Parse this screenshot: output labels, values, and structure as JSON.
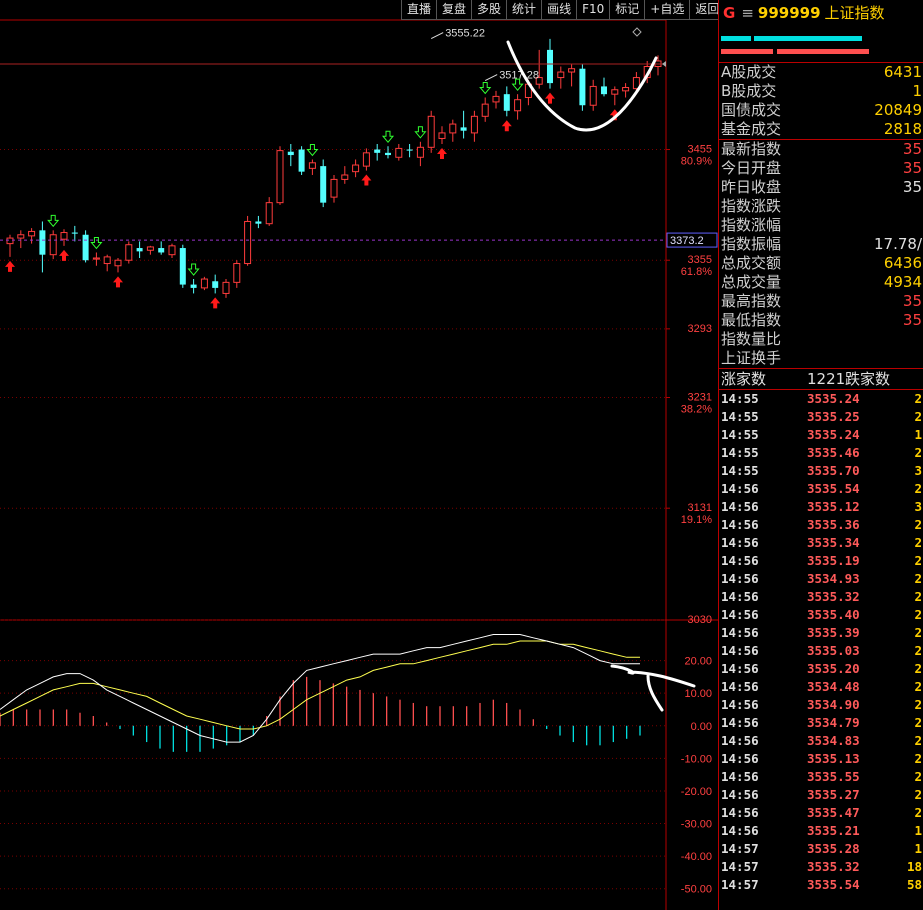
{
  "toolbar": [
    "直播",
    "复盘",
    "多股",
    "统计",
    "画线",
    "F10",
    "标记",
    "+自选",
    "返回"
  ],
  "header": {
    "prefix": "G",
    "eq": "≡",
    "code": "999999",
    "name": "上证指数"
  },
  "colors": {
    "up": "#ff3c3c",
    "down": "#54ffff",
    "axis": "#b40000",
    "dif": "#ffffff",
    "dea": "#ffff50",
    "cyanbar": "#00e0e0",
    "redbar": "#ff5050"
  },
  "stats": [
    {
      "label": "A股成交",
      "value": "6431",
      "color": "#ffd000"
    },
    {
      "label": "B股成交",
      "value": "1",
      "color": "#ffd000"
    },
    {
      "label": "国债成交",
      "value": "20849",
      "color": "#ffd000"
    },
    {
      "label": "基金成交",
      "value": "2818",
      "color": "#ffd000"
    },
    {
      "label": "最新指数",
      "value": "35",
      "color": "#ff4040",
      "sep": true
    },
    {
      "label": "今日开盘",
      "value": "35",
      "color": "#ff4040"
    },
    {
      "label": "昨日收盘",
      "value": "35",
      "color": "#e0e0e0"
    },
    {
      "label": "指数涨跌",
      "value": "",
      "color": "#ff4040"
    },
    {
      "label": "指数涨幅",
      "value": "",
      "color": "#ff4040"
    },
    {
      "label": "指数振幅",
      "value": "17.78/",
      "color": "#e0e0e0"
    },
    {
      "label": "总成交额",
      "value": "6436",
      "color": "#ffd000"
    },
    {
      "label": "总成交量",
      "value": "4934",
      "color": "#ffd000"
    },
    {
      "label": "最高指数",
      "value": "35",
      "color": "#ff4040"
    },
    {
      "label": "最低指数",
      "value": "35",
      "color": "#ff4040"
    },
    {
      "label": "指数量比",
      "value": "",
      "color": "#e0e0e0"
    },
    {
      "label": "上证换手",
      "value": "",
      "color": "#e0e0e0"
    }
  ],
  "advance": {
    "up_label": "涨家数",
    "up_value": "1221",
    "down_label": "跌家数"
  },
  "ticks": [
    {
      "t": "14:55",
      "p": "3535.24",
      "v": "2"
    },
    {
      "t": "14:55",
      "p": "3535.25",
      "v": "2"
    },
    {
      "t": "14:55",
      "p": "3535.24",
      "v": "1"
    },
    {
      "t": "14:55",
      "p": "3535.46",
      "v": "2"
    },
    {
      "t": "14:55",
      "p": "3535.70",
      "v": "3"
    },
    {
      "t": "14:56",
      "p": "3535.54",
      "v": "2"
    },
    {
      "t": "14:56",
      "p": "3535.12",
      "v": "3"
    },
    {
      "t": "14:56",
      "p": "3535.36",
      "v": "2"
    },
    {
      "t": "14:56",
      "p": "3535.34",
      "v": "2"
    },
    {
      "t": "14:56",
      "p": "3535.19",
      "v": "2"
    },
    {
      "t": "14:56",
      "p": "3534.93",
      "v": "2"
    },
    {
      "t": "14:56",
      "p": "3535.32",
      "v": "2"
    },
    {
      "t": "14:56",
      "p": "3535.40",
      "v": "2"
    },
    {
      "t": "14:56",
      "p": "3535.39",
      "v": "2"
    },
    {
      "t": "14:56",
      "p": "3535.03",
      "v": "2"
    },
    {
      "t": "14:56",
      "p": "3535.20",
      "v": "2"
    },
    {
      "t": "14:56",
      "p": "3534.48",
      "v": "2"
    },
    {
      "t": "14:56",
      "p": "3534.90",
      "v": "2"
    },
    {
      "t": "14:56",
      "p": "3534.79",
      "v": "2"
    },
    {
      "t": "14:56",
      "p": "3534.83",
      "v": "2"
    },
    {
      "t": "14:56",
      "p": "3535.13",
      "v": "2"
    },
    {
      "t": "14:56",
      "p": "3535.55",
      "v": "2"
    },
    {
      "t": "14:56",
      "p": "3535.27",
      "v": "2"
    },
    {
      "t": "14:56",
      "p": "3535.47",
      "v": "2"
    },
    {
      "t": "14:56",
      "p": "3535.21",
      "v": "1"
    },
    {
      "t": "14:57",
      "p": "3535.28",
      "v": "1"
    },
    {
      "t": "14:57",
      "p": "3535.32",
      "v": "18"
    },
    {
      "t": "14:57",
      "p": "3535.54",
      "v": "58"
    }
  ],
  "chart_data": {
    "type": "candlestick",
    "price_axis": {
      "range": [
        3030,
        3572
      ],
      "ticks": [
        {
          "value": 3455,
          "label": "3455",
          "pct": "80.9%"
        },
        {
          "value": 3355,
          "label": "3355",
          "pct": "61.8%"
        },
        {
          "value": 3293,
          "label": "3293",
          "pct": ""
        },
        {
          "value": 3231,
          "label": "3231",
          "pct": "38.2%"
        },
        {
          "value": 3131,
          "label": "3131",
          "pct": "19.1%"
        },
        {
          "value": 3030,
          "label": "3030",
          "pct": ""
        }
      ]
    },
    "current_price_label": "3373.2",
    "current_price_value": 3373.2,
    "annotations": [
      {
        "label": "3555.22",
        "value": 3555.22,
        "index": 39
      },
      {
        "label": "3517.28",
        "value": 3517.28,
        "index": 44
      }
    ],
    "candles": [
      {
        "o": 3370,
        "h": 3378,
        "l": 3358,
        "c": 3375
      },
      {
        "o": 3375,
        "h": 3382,
        "l": 3366,
        "c": 3378
      },
      {
        "o": 3377,
        "h": 3384,
        "l": 3370,
        "c": 3381
      },
      {
        "o": 3382,
        "h": 3390,
        "l": 3344,
        "c": 3360
      },
      {
        "o": 3360,
        "h": 3382,
        "l": 3356,
        "c": 3378
      },
      {
        "o": 3374,
        "h": 3383,
        "l": 3368,
        "c": 3380
      },
      {
        "o": 3380,
        "h": 3386,
        "l": 3372,
        "c": 3379
      },
      {
        "o": 3378,
        "h": 3382,
        "l": 3353,
        "c": 3355
      },
      {
        "o": 3356,
        "h": 3362,
        "l": 3350,
        "c": 3357
      },
      {
        "o": 3352,
        "h": 3360,
        "l": 3345,
        "c": 3358
      },
      {
        "o": 3350,
        "h": 3357,
        "l": 3344,
        "c": 3355
      },
      {
        "o": 3355,
        "h": 3372,
        "l": 3352,
        "c": 3369
      },
      {
        "o": 3366,
        "h": 3372,
        "l": 3357,
        "c": 3363
      },
      {
        "o": 3364,
        "h": 3368,
        "l": 3360,
        "c": 3367
      },
      {
        "o": 3366,
        "h": 3372,
        "l": 3360,
        "c": 3362
      },
      {
        "o": 3360,
        "h": 3370,
        "l": 3357,
        "c": 3368
      },
      {
        "o": 3366,
        "h": 3369,
        "l": 3330,
        "c": 3333
      },
      {
        "o": 3333,
        "h": 3338,
        "l": 3325,
        "c": 3330
      },
      {
        "o": 3330,
        "h": 3340,
        "l": 3328,
        "c": 3338
      },
      {
        "o": 3336,
        "h": 3342,
        "l": 3325,
        "c": 3330
      },
      {
        "o": 3325,
        "h": 3338,
        "l": 3321,
        "c": 3335
      },
      {
        "o": 3335,
        "h": 3355,
        "l": 3330,
        "c": 3352
      },
      {
        "o": 3352,
        "h": 3395,
        "l": 3350,
        "c": 3390
      },
      {
        "o": 3390,
        "h": 3395,
        "l": 3384,
        "c": 3388
      },
      {
        "o": 3388,
        "h": 3412,
        "l": 3386,
        "c": 3407
      },
      {
        "o": 3407,
        "h": 3458,
        "l": 3405,
        "c": 3454
      },
      {
        "o": 3453,
        "h": 3460,
        "l": 3440,
        "c": 3450
      },
      {
        "o": 3455,
        "h": 3458,
        "l": 3432,
        "c": 3435
      },
      {
        "o": 3438,
        "h": 3446,
        "l": 3432,
        "c": 3443
      },
      {
        "o": 3440,
        "h": 3446,
        "l": 3403,
        "c": 3407
      },
      {
        "o": 3412,
        "h": 3432,
        "l": 3407,
        "c": 3428
      },
      {
        "o": 3428,
        "h": 3440,
        "l": 3424,
        "c": 3432
      },
      {
        "o": 3435,
        "h": 3446,
        "l": 3430,
        "c": 3441
      },
      {
        "o": 3440,
        "h": 3456,
        "l": 3436,
        "c": 3452
      },
      {
        "o": 3455,
        "h": 3460,
        "l": 3445,
        "c": 3452
      },
      {
        "o": 3452,
        "h": 3458,
        "l": 3447,
        "c": 3450
      },
      {
        "o": 3448,
        "h": 3460,
        "l": 3445,
        "c": 3456
      },
      {
        "o": 3455,
        "h": 3460,
        "l": 3448,
        "c": 3454
      },
      {
        "o": 3448,
        "h": 3462,
        "l": 3440,
        "c": 3457
      },
      {
        "o": 3457,
        "h": 3490,
        "l": 3452,
        "c": 3485
      },
      {
        "o": 3465,
        "h": 3476,
        "l": 3460,
        "c": 3470
      },
      {
        "o": 3470,
        "h": 3482,
        "l": 3462,
        "c": 3478
      },
      {
        "o": 3475,
        "h": 3490,
        "l": 3465,
        "c": 3472
      },
      {
        "o": 3470,
        "h": 3490,
        "l": 3462,
        "c": 3485
      },
      {
        "o": 3485,
        "h": 3502,
        "l": 3480,
        "c": 3496
      },
      {
        "o": 3498,
        "h": 3508,
        "l": 3492,
        "c": 3503
      },
      {
        "o": 3505,
        "h": 3512,
        "l": 3485,
        "c": 3490
      },
      {
        "o": 3490,
        "h": 3505,
        "l": 3482,
        "c": 3500
      },
      {
        "o": 3502,
        "h": 3518,
        "l": 3495,
        "c": 3514
      },
      {
        "o": 3514,
        "h": 3545,
        "l": 3510,
        "c": 3520
      },
      {
        "o": 3545,
        "h": 3555,
        "l": 3510,
        "c": 3515
      },
      {
        "o": 3520,
        "h": 3530,
        "l": 3510,
        "c": 3525
      },
      {
        "o": 3525,
        "h": 3532,
        "l": 3512,
        "c": 3528
      },
      {
        "o": 3528,
        "h": 3532,
        "l": 3490,
        "c": 3495
      },
      {
        "o": 3495,
        "h": 3518,
        "l": 3490,
        "c": 3512
      },
      {
        "o": 3512,
        "h": 3520,
        "l": 3503,
        "c": 3505
      },
      {
        "o": 3505,
        "h": 3512,
        "l": 3495,
        "c": 3509
      },
      {
        "o": 3508,
        "h": 3515,
        "l": 3502,
        "c": 3511
      },
      {
        "o": 3510,
        "h": 3525,
        "l": 3505,
        "c": 3520
      },
      {
        "o": 3520,
        "h": 3535,
        "l": 3515,
        "c": 3530
      },
      {
        "o": 3530,
        "h": 3540,
        "l": 3522,
        "c": 3535
      }
    ],
    "up_arrow_index": [
      0,
      5,
      10,
      19,
      33,
      40,
      46,
      50,
      56
    ],
    "down_arrow_index": [
      4,
      8,
      17,
      28,
      35,
      38,
      44,
      47
    ],
    "macd": {
      "range": [
        -55,
        30
      ],
      "ticks": [
        20,
        10,
        0,
        -10,
        -20,
        -30,
        -40,
        -50
      ],
      "dif": [
        5,
        8,
        11,
        13,
        15,
        16,
        16,
        14,
        11,
        9,
        7,
        5,
        3,
        1,
        -1,
        -3,
        -4,
        -5,
        -5,
        -3,
        2,
        8,
        13,
        17,
        18,
        19,
        20,
        21,
        22,
        22,
        22,
        23,
        24,
        24,
        25,
        26,
        27,
        28,
        28,
        28,
        27,
        26,
        25,
        24,
        22,
        20,
        19,
        19,
        19
      ],
      "dea": [
        3,
        5,
        7,
        9,
        11,
        12,
        13,
        13,
        12,
        11,
        10,
        9,
        7,
        5,
        3,
        2,
        1,
        0,
        -1,
        -1,
        0,
        2,
        5,
        8,
        10,
        12,
        14,
        15,
        17,
        18,
        19,
        19,
        20,
        21,
        22,
        23,
        24,
        25,
        25,
        26,
        26,
        26,
        25,
        25,
        24,
        23,
        22,
        21,
        21
      ],
      "hist": [
        4,
        5,
        5,
        5,
        5,
        5,
        4,
        3,
        1,
        -1,
        -3,
        -5,
        -7,
        -8,
        -8,
        -8,
        -7,
        -6,
        -5,
        -3,
        3,
        9,
        14,
        15,
        14,
        13,
        12,
        11,
        10,
        9,
        8,
        7,
        6,
        6,
        6,
        6,
        7,
        8,
        7,
        5,
        2,
        -1,
        -3,
        -5,
        -6,
        -6,
        -5,
        -4,
        -3
      ]
    }
  }
}
